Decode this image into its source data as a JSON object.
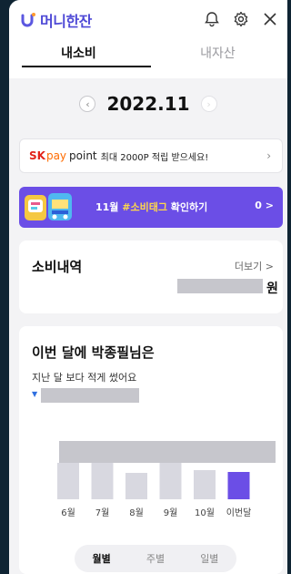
{
  "header": {
    "app_name": "머니한잔",
    "tabs": [
      {
        "label": "내소비",
        "active": true
      },
      {
        "label": "내자산",
        "active": false
      }
    ]
  },
  "month": {
    "label": "2022.11",
    "prev_icon": "chevron-left-icon",
    "next_icon": "chevron-right-icon"
  },
  "sk_banner": {
    "brand": "SK",
    "brand_pay": "pay",
    "point": "point",
    "message": "최대 2000P 적립 받으세요!"
  },
  "tag_banner": {
    "prefix": "11월 ",
    "highlight": "#소비태그",
    "suffix": " 확인하기",
    "count": "0 >"
  },
  "spending": {
    "title": "소비내역",
    "more_label": "더보기 >",
    "currency": "원"
  },
  "compare": {
    "title": "이번 달에 박종필님은",
    "subtitle": "지난 달 보다 적게 썼어요"
  },
  "chart_data": {
    "type": "bar",
    "categories": [
      "6월",
      "7월",
      "8월",
      "9월",
      "10월",
      "이번달"
    ],
    "values": [
      40,
      40,
      29,
      40,
      32,
      30
    ],
    "ylim": [
      0,
      100
    ],
    "highlight_index": 5,
    "colors": {
      "past": "#d8d8e0",
      "current": "#6b4ee6"
    }
  },
  "period_toggle": {
    "options": [
      {
        "label": "월별",
        "active": true
      },
      {
        "label": "주별",
        "active": false
      },
      {
        "label": "일별",
        "active": false
      }
    ]
  },
  "colors": {
    "accent": "#6b4ee6",
    "sk_red": "#e2231a",
    "sk_orange": "#ff6b00"
  }
}
